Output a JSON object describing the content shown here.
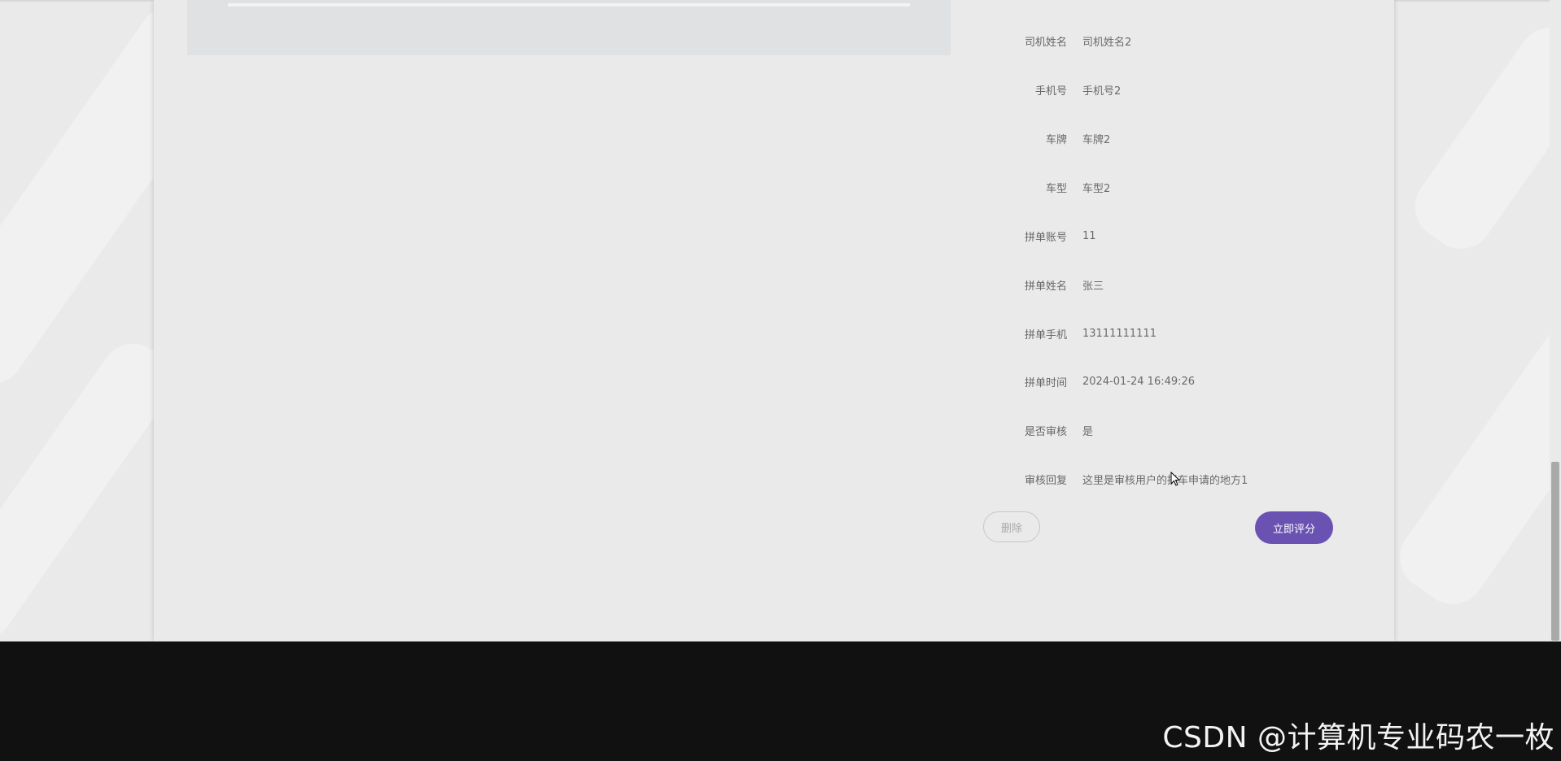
{
  "details": {
    "rows": [
      {
        "label": "司机姓名",
        "value": "司机姓名2"
      },
      {
        "label": "手机号",
        "value": "手机号2"
      },
      {
        "label": "车牌",
        "value": "车牌2"
      },
      {
        "label": "车型",
        "value": "车型2"
      },
      {
        "label": "拼单账号",
        "value": "11"
      },
      {
        "label": "拼单姓名",
        "value": "张三"
      },
      {
        "label": "拼单手机",
        "value": "13111111111"
      },
      {
        "label": "拼单时间",
        "value": "2024-01-24 16:49:26"
      },
      {
        "label": "是否审核",
        "value": "是"
      },
      {
        "label": "审核回复",
        "value": "这里是审核用户的拼车申请的地方1"
      }
    ]
  },
  "actions": {
    "delete_label": "删除",
    "rate_label": "立即评分"
  },
  "watermark": {
    "text": "CSDN @计算机专业码农一枚"
  },
  "colors": {
    "accent": "#6a52b3",
    "page_background": "#eaeaea",
    "footer_background": "#111111"
  }
}
